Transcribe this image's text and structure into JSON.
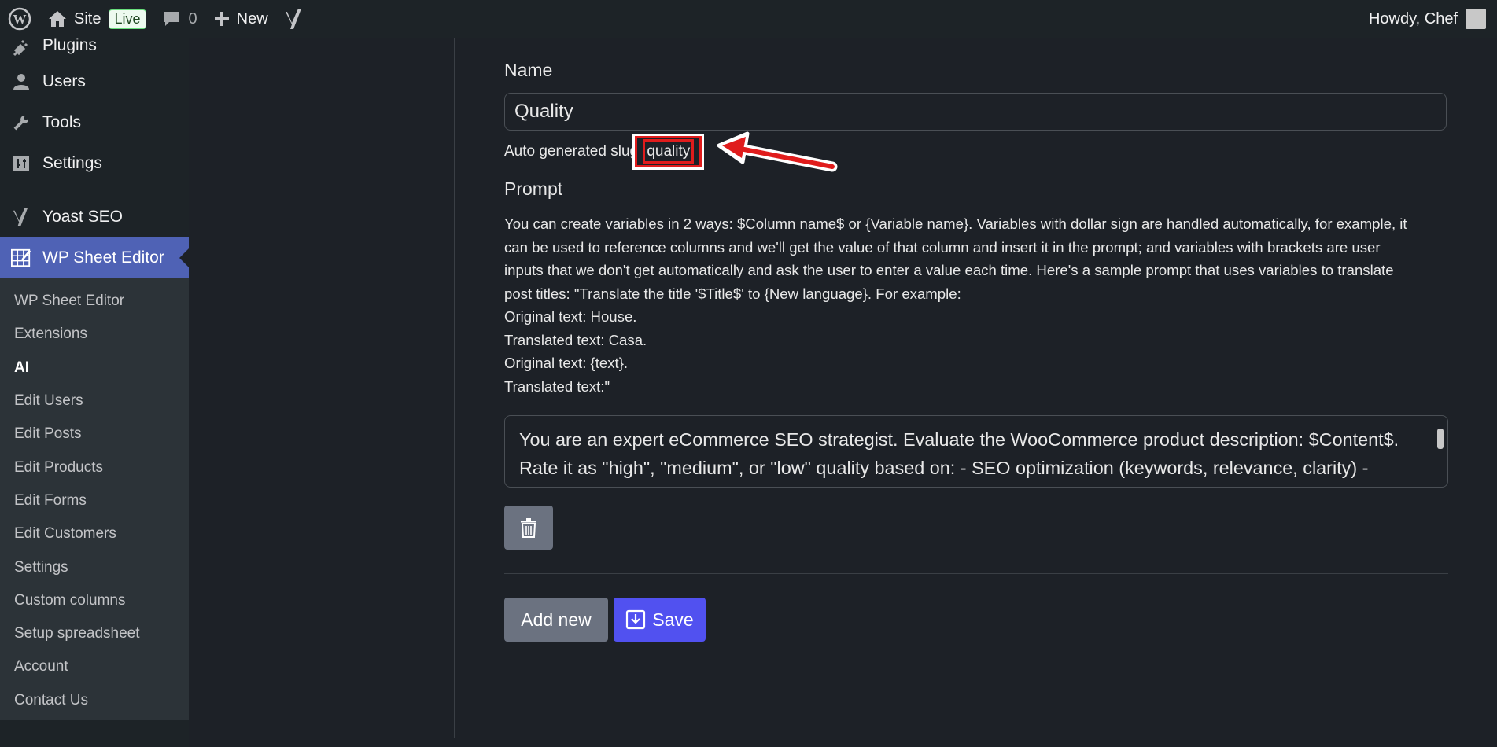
{
  "adminbar": {
    "site_label": "Site",
    "live_badge": "Live",
    "comments_count": "0",
    "new_label": "New",
    "howdy": "Howdy, Chef"
  },
  "sidebar": {
    "items": [
      {
        "label": "Plugins",
        "icon": "plugin-icon"
      },
      {
        "label": "Users",
        "icon": "user-icon"
      },
      {
        "label": "Tools",
        "icon": "wrench-icon"
      },
      {
        "label": "Settings",
        "icon": "settings-icon"
      },
      {
        "label": "Yoast SEO",
        "icon": "yoast-icon"
      },
      {
        "label": "WP Sheet Editor",
        "icon": "sheet-editor-icon"
      }
    ],
    "submenu": [
      "WP Sheet Editor",
      "Extensions",
      "AI",
      "Edit Users",
      "Edit Posts",
      "Edit Products",
      "Edit Forms",
      "Edit Customers",
      "Settings",
      "Custom columns",
      "Setup spreadsheet",
      "Account",
      "Contact Us"
    ],
    "active_submenu": "AI"
  },
  "form": {
    "name_label": "Name",
    "name_value": "Quality",
    "slug_prefix": "Auto generated slug:",
    "slug_value": "quality",
    "prompt_label": "Prompt",
    "help_lines": [
      "You can create variables in 2 ways: $Column name$ or {Variable name}. Variables with dollar sign are handled automatically, for example, it",
      "can be used to reference columns and we'll get the value of that column and insert it in the prompt; and variables with brackets are user",
      "inputs that we don't get automatically and ask the user to enter a value each time. Here's a sample prompt that uses variables to translate",
      "post titles: \"Translate the title '$Title$' to {New language}. For example:",
      "Original text: House.",
      "Translated text: Casa.",
      "Original text: {text}.",
      "Translated text:\""
    ],
    "prompt_lines": [
      "You are an expert eCommerce SEO strategist. Evaluate the WooCommerce product description: $Content$.",
      "Rate it as \"high\", \"medium\", or \"low\" quality based on: - SEO optimization (keywords, relevance, clarity) -"
    ],
    "add_new_label": "Add new",
    "save_label": "Save"
  },
  "colors": {
    "accent": "#5151f0",
    "menu_current": "#4f62b5",
    "annotation_red": "#e01c1c"
  }
}
